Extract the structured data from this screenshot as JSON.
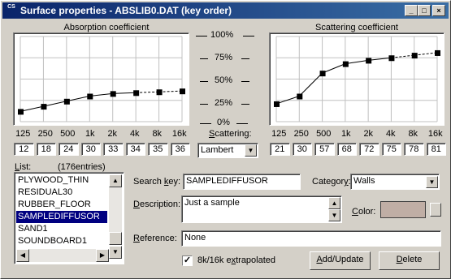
{
  "window": {
    "title": "Surface properties - ABSLIB0.DAT (key order)",
    "app_icon": "CS"
  },
  "titlebar_buttons": {
    "minimize": "_",
    "maximize": "□",
    "close": "×"
  },
  "percent_labels": [
    "100%",
    "75%",
    "50%",
    "25%",
    "0%"
  ],
  "absorption": {
    "title": "Absorption coefficient"
  },
  "scattering_chart": {
    "title": "Scattering coefficient"
  },
  "frequencies": [
    "125",
    "250",
    "500",
    "1k",
    "2k",
    "4k",
    "8k",
    "16k"
  ],
  "chart_data": [
    {
      "type": "line",
      "title": "Absorption coefficient",
      "categories": [
        "125",
        "250",
        "500",
        "1k",
        "2k",
        "4k",
        "8k",
        "16k"
      ],
      "values": [
        12,
        18,
        24,
        30,
        33,
        34,
        35,
        36
      ],
      "ylim": [
        0,
        100
      ],
      "extrapolated_from": "8k",
      "grid": true
    },
    {
      "type": "line",
      "title": "Scattering coefficient",
      "categories": [
        "125",
        "250",
        "500",
        "1k",
        "2k",
        "4k",
        "8k",
        "16k"
      ],
      "values": [
        21,
        30,
        57,
        68,
        72,
        75,
        78,
        81
      ],
      "ylim": [
        0,
        100
      ],
      "extrapolated_from": "8k",
      "grid": true
    }
  ],
  "scattering": {
    "label_pre": "",
    "label_u": "S",
    "label_post": "cattering:",
    "value": "Lambert"
  },
  "list": {
    "label_u": "L",
    "label_post": "ist:",
    "count": "(176entries)",
    "items": [
      "PLYWOOD_THIN",
      "RESIDUAL30",
      "RUBBER_FLOOR",
      "SAMPLEDIFFUSOR",
      "SAND1",
      "SOUNDBOARD1"
    ],
    "selected_index": 3
  },
  "search_key": {
    "label_pre": "Search ",
    "label_u": "k",
    "label_post": "ey:",
    "value": "SAMPLEDIFFUSOR"
  },
  "category": {
    "label_pre": "Categor",
    "label_u": "y",
    "label_post": ":",
    "value": "Walls"
  },
  "description": {
    "label_u": "D",
    "label_post": "escription:",
    "value": "Just a sample"
  },
  "color": {
    "label_u": "C",
    "label_post": "olor:",
    "swatch": "#c0aea5"
  },
  "reference": {
    "label_u": "R",
    "label_post": "eference:",
    "value": "None"
  },
  "extrapolated": {
    "label_pre": "8k/16k e",
    "label_u": "x",
    "label_post": "trapolated",
    "checked": "✓"
  },
  "buttons": {
    "add_u": "A",
    "add_post": "dd/Update",
    "delete_u": "D",
    "delete_post": "elete"
  },
  "colors": {
    "title_start": "#0a246a",
    "title_end": "#3a6ea5",
    "selection": "#000080",
    "face": "#d4d0c8"
  }
}
